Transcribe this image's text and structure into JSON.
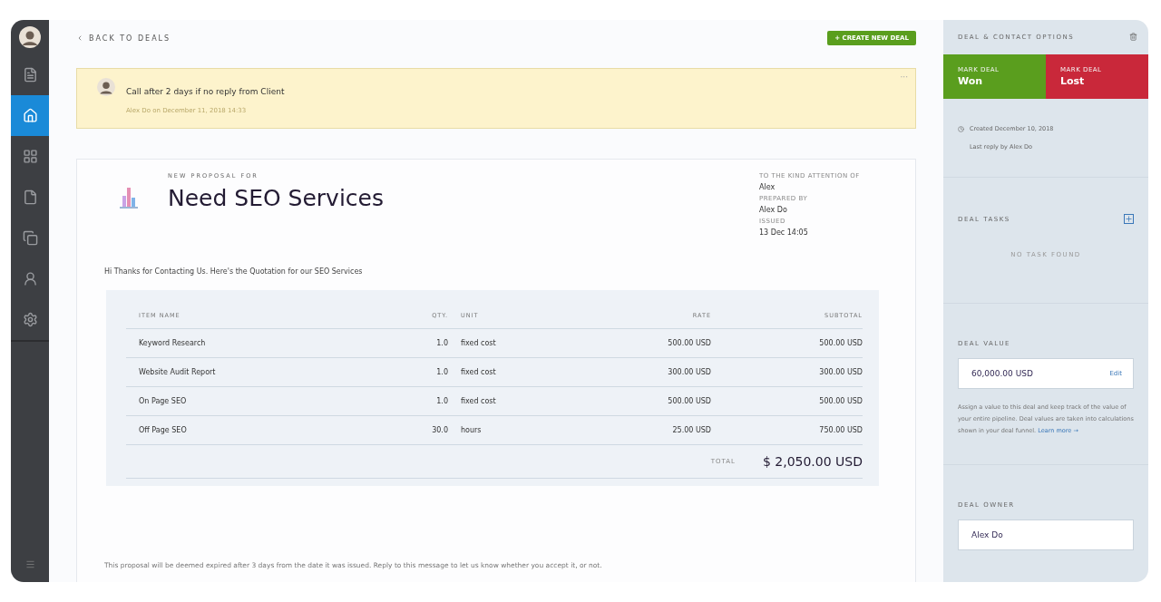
{
  "sidebar": {
    "items": [
      {
        "kind": "notes",
        "selected": false
      },
      {
        "kind": "home",
        "selected": true
      },
      {
        "kind": "board",
        "selected": false
      },
      {
        "kind": "document",
        "selected": false
      },
      {
        "kind": "copies",
        "selected": false
      },
      {
        "kind": "contacts",
        "selected": false
      },
      {
        "kind": "settings",
        "selected": false
      }
    ]
  },
  "back_link": "BACK TO DEALS",
  "create_button": "+ CREATE NEW DEAL",
  "note": {
    "text": "Call after 2 days if no reply from Client",
    "meta": "Alex Do on December 11, 2018 14:33",
    "menu": "···"
  },
  "proposal": {
    "eyebrow": "NEW PROPOSAL FOR",
    "title": "Need SEO Services",
    "details": [
      {
        "label": "TO THE KIND ATTENTION OF",
        "value": "Alex"
      },
      {
        "label": "PREPARED BY",
        "value": "Alex Do"
      },
      {
        "label": "ISSUED",
        "value": "13 Dec 14:05"
      }
    ],
    "greeting": "Hi Thanks for Contacting Us. Here's the Quotation for our SEO Services",
    "table": {
      "columns": [
        "ITEM NAME",
        "QTY.",
        "UNIT",
        "RATE",
        "SUBTOTAL"
      ],
      "rows": [
        [
          "Keyword Research",
          "1.0",
          "fixed cost",
          "500.00 USD",
          "500.00 USD"
        ],
        [
          "Website Audit Report",
          "1.0",
          "fixed cost",
          "300.00 USD",
          "300.00 USD"
        ],
        [
          "On Page SEO",
          "1.0",
          "fixed cost",
          "500.00 USD",
          "500.00 USD"
        ],
        [
          "Off Page SEO",
          "30.0",
          "hours",
          "25.00 USD",
          "750.00 USD"
        ]
      ],
      "total_label": "TOTAL",
      "total": "$ 2,050.00 USD"
    },
    "footer": "This proposal will be deemed expired after 3 days from the date it was issued. Reply to this message to let us know whether you accept it, or not."
  },
  "options": {
    "title": "DEAL & CONTACT OPTIONS",
    "marks": [
      {
        "kind": "won",
        "label": "MARK DEAL",
        "value": "Won"
      },
      {
        "kind": "lost",
        "label": "MARK DEAL",
        "value": "Lost"
      }
    ],
    "created": "Created December 10, 2018",
    "last_reply": "Last reply by Alex Do",
    "tasks": {
      "title": "DEAL TASKS",
      "empty": "NO TASK FOUND"
    },
    "value": {
      "title": "DEAL VALUE",
      "amount": "60,000.00 USD",
      "edit": "Edit",
      "help": "Assign a value to this deal and keep track of the value of your entire pipeline. Deal values are taken into calculations shown in your deal funnel.",
      "learn_more": "Learn more →"
    },
    "owner": {
      "title": "DEAL OWNER",
      "name": "Alex Do"
    }
  }
}
